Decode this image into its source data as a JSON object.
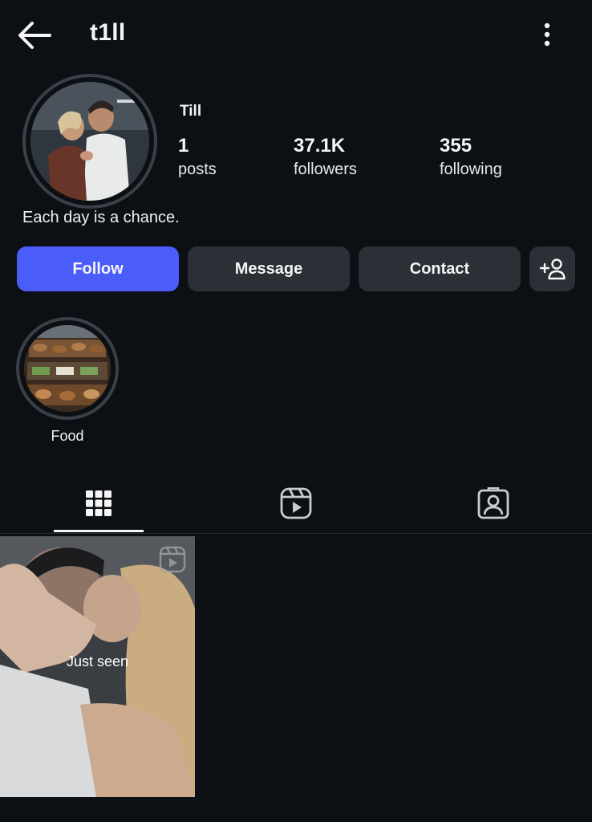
{
  "header": {
    "username": "t1ll",
    "back_icon": "arrow-left-icon",
    "more_icon": "more-vertical-icon"
  },
  "profile": {
    "display_name": "Till",
    "bio": "Each day is a chance.",
    "avatar": "couple-photo",
    "stats": {
      "posts_value": "1",
      "posts_label": "posts",
      "followers_value": "37.1K",
      "followers_label": "followers",
      "following_value": "355",
      "following_label": "following"
    }
  },
  "actions": {
    "follow_label": "Follow",
    "message_label": "Message",
    "contact_label": "Contact",
    "add_user_icon": "person-add-icon"
  },
  "highlights": [
    {
      "label": "Food",
      "image": "pastry-display-photo"
    }
  ],
  "tabs": [
    {
      "icon": "grid-icon",
      "active": true
    },
    {
      "icon": "reels-icon",
      "active": false
    },
    {
      "icon": "tagged-icon",
      "active": false
    }
  ],
  "posts": [
    {
      "overlay_text": "Just seen",
      "type_icon": "reels-icon"
    }
  ],
  "colors": {
    "background": "#0c1014",
    "follow_button": "#4a5df9",
    "secondary_button": "#2b3037",
    "ring": "#3b4048"
  }
}
